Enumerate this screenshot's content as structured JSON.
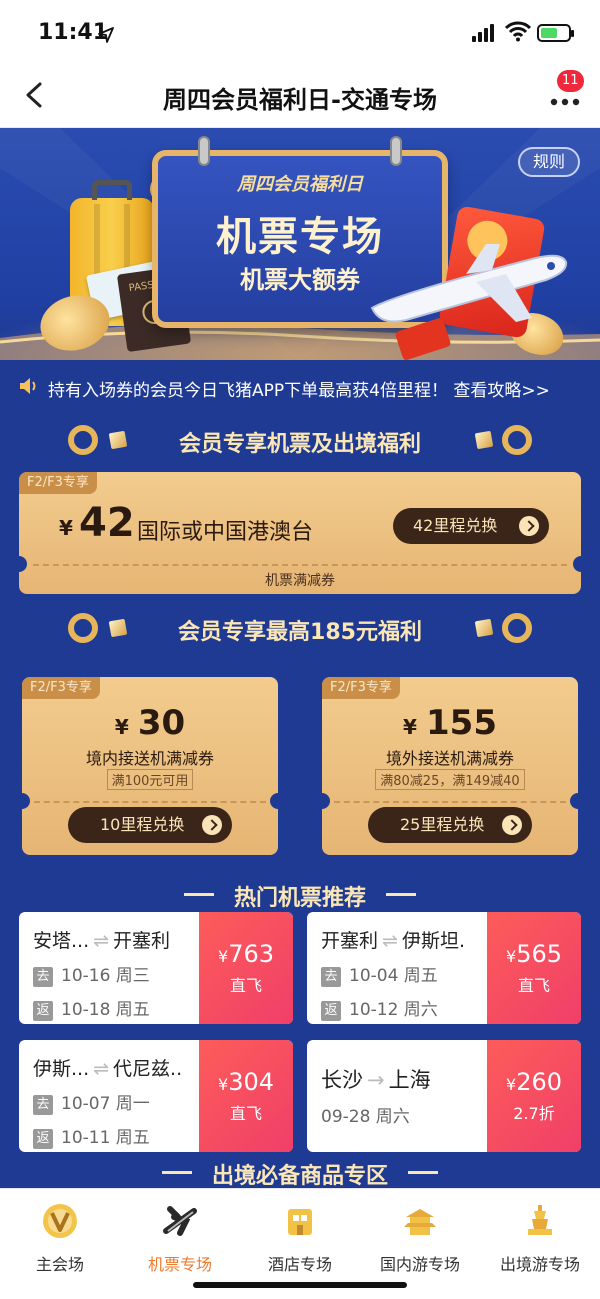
{
  "status": {
    "time": "11:41",
    "location_icon": "location-arrow-icon",
    "battery_level": 0.6
  },
  "nav": {
    "title": "周四会员福利日-交通专场",
    "badge": "11"
  },
  "hero": {
    "banner_line1": "周四会员福利日",
    "heading": "机票专场",
    "subheading": "机票大额券",
    "rules": "规则"
  },
  "notice": "持有入场券的会员今日飞猪APP下单最高获4倍里程！ 查看攻略>>",
  "section1": {
    "title": "会员专享机票及出境福利",
    "coupon": {
      "tag": "F2/F3专享",
      "currency": "¥",
      "amount": "42",
      "desc": "国际或中国港澳台",
      "button": "42里程兑换",
      "footer": "机票满减券"
    }
  },
  "section2": {
    "title": "会员专享最高185元福利",
    "coupons": [
      {
        "tag": "F2/F3专享",
        "currency": "¥",
        "amount": "30",
        "desc": "境内接送机满减券",
        "cond": "满100元可用",
        "button": "10里程兑换"
      },
      {
        "tag": "F2/F3专享",
        "currency": "¥",
        "amount": "155",
        "desc": "境外接送机满减券",
        "cond": "满80减25，满149减40",
        "button": "25里程兑换"
      }
    ]
  },
  "section3": {
    "title": "热门机票推荐",
    "flights": [
      {
        "from": "安塔...",
        "to": "开塞利",
        "go_key": "去",
        "go": "10-16 周三",
        "back_key": "返",
        "back": "10-18 周五",
        "currency": "¥",
        "price": "763",
        "sub": "直飞"
      },
      {
        "from": "开塞利",
        "to": "伊斯坦.",
        "go_key": "去",
        "go": "10-04 周五",
        "back_key": "返",
        "back": "10-12 周六",
        "currency": "¥",
        "price": "565",
        "sub": "直飞"
      },
      {
        "from": "伊斯...",
        "to": "代尼兹..",
        "go_key": "去",
        "go": "10-07 周一",
        "back_key": "返",
        "back": "10-11 周五",
        "currency": "¥",
        "price": "304",
        "sub": "直飞"
      },
      {
        "from": "长沙",
        "to": "上海",
        "date": "09-28 周六",
        "currency": "¥",
        "price": "260",
        "sub": "2.7折"
      }
    ]
  },
  "section4": {
    "title": "出境必备商品专区"
  },
  "tabs": [
    {
      "label": "主会场",
      "icon": "v-logo-icon"
    },
    {
      "label": "机票专场",
      "icon": "airplane-icon"
    },
    {
      "label": "酒店专场",
      "icon": "hotel-icon"
    },
    {
      "label": "国内游专场",
      "icon": "temple-icon"
    },
    {
      "label": "出境游专场",
      "icon": "tower-icon"
    }
  ],
  "active_tab": 1,
  "colors": {
    "primary_bg": "#1f3a93",
    "gold": "#f2cc8e",
    "price_red": "#f03f68",
    "accent": "#ee7a2e"
  }
}
